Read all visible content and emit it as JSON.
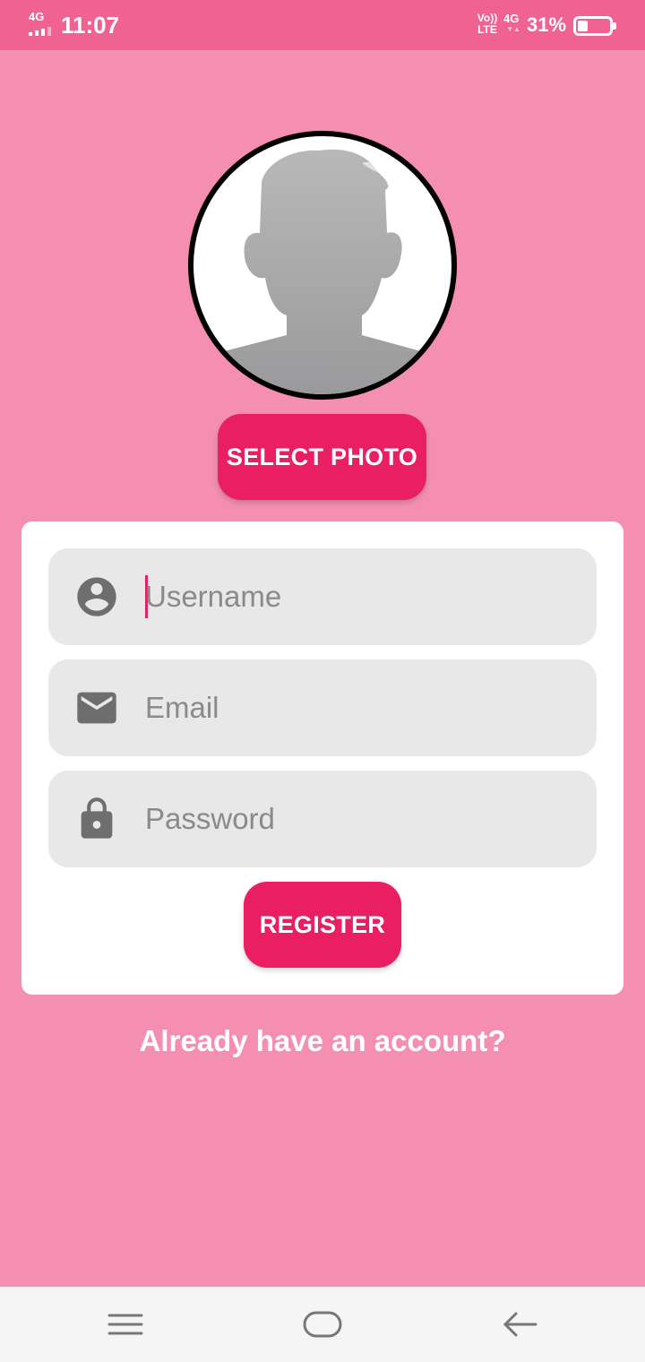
{
  "status_bar": {
    "network_left": "4G",
    "time": "11:07",
    "volte_top": "Vo))",
    "volte_bottom": "LTE",
    "network_right": "4G",
    "battery_percent": "31%",
    "battery_level": 0.31
  },
  "avatar": {
    "icon": "person-placeholder-icon"
  },
  "select_photo_button": "SELECT PHOTO",
  "form": {
    "username": {
      "placeholder": "Username",
      "value": "",
      "icon": "account-circle-icon"
    },
    "email": {
      "placeholder": "Email",
      "value": "",
      "icon": "email-icon"
    },
    "password": {
      "placeholder": "Password",
      "value": "",
      "icon": "lock-icon"
    },
    "register_button": "REGISTER"
  },
  "login_link": "Already have an account?",
  "nav_bar": {
    "menu_icon": "menu-icon",
    "home_icon": "home-icon",
    "back_icon": "back-arrow-icon"
  },
  "colors": {
    "background": "#f48fb1",
    "status_bar": "#f06292",
    "accent": "#e91e63",
    "field_bg": "#e8e8e8",
    "icon_gray": "#6e6e6e"
  }
}
